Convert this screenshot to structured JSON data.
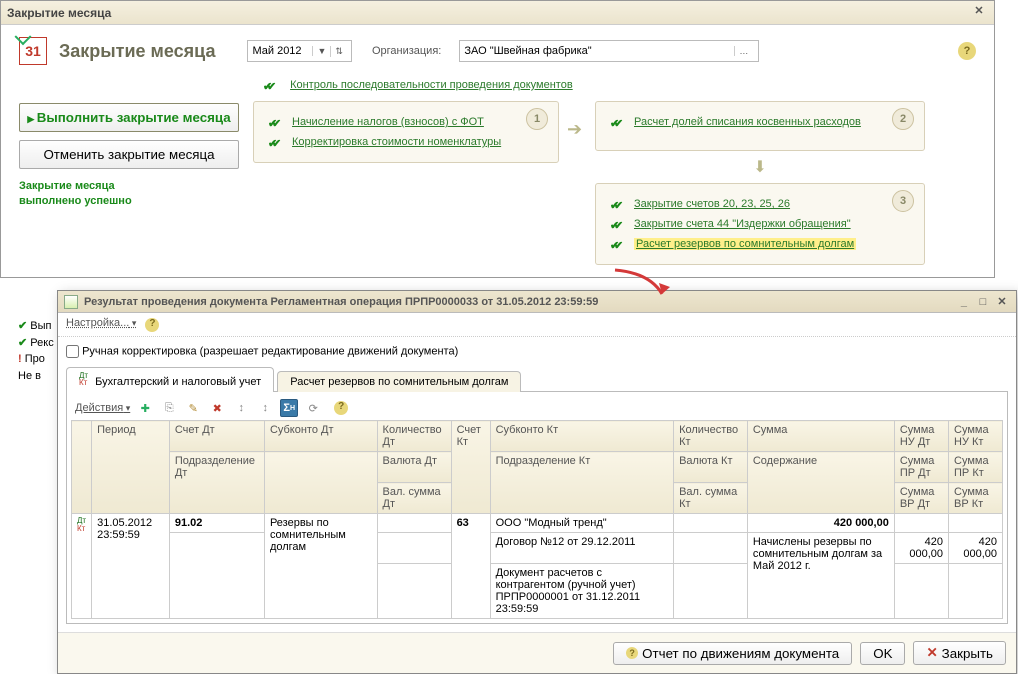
{
  "window": {
    "title": "Закрытие месяца"
  },
  "header": {
    "cal_day": "31",
    "title": "Закрытие месяца",
    "period": "Май 2012",
    "org_label": "Организация:",
    "org_value": "ЗАО \"Швейная фабрика\""
  },
  "left": {
    "execute": "Выполнить закрытие месяца",
    "cancel": "Отменить закрытие месяца",
    "success_l1": "Закрытие месяца",
    "success_l2": "выполнено успешно"
  },
  "ctrl_link": "Контроль последовательности проведения документов",
  "step1": {
    "num": "1",
    "link1": "Начисление налогов (взносов) с ФОТ",
    "link2": "Корректировка стоимости номенклатуры"
  },
  "step2": {
    "num": "2",
    "link1": "Расчет долей списания косвенных расходов"
  },
  "step3": {
    "num": "3",
    "link1": "Закрытие счетов 20, 23, 25, 26",
    "link2": "Закрытие счета 44 \"Издержки обращения\"",
    "link3": "Расчет резервов по сомнительным долгам"
  },
  "cut": {
    "l1": "Вып",
    "l2": "Рекс",
    "l3": "Про",
    "l4": "Не в"
  },
  "overlay": {
    "title": "Результат проведения документа Регламентная операция ПРПР0000033 от 31.05.2012 23:59:59",
    "menu_settings": "Настройка...",
    "checkbox_label": "Ручная корректировка (разрешает редактирование движений документа)",
    "tab1": "Бухгалтерский и налоговый учет",
    "tab2": "Расчет резервов по сомнительным долгам",
    "actions": "Действия",
    "footer_report": "Отчет по движениям документа",
    "footer_ok": "OK",
    "footer_close": "Закрыть"
  },
  "grid": {
    "headers": {
      "r1": {
        "period": "Период",
        "acc_dt": "Счет Дт",
        "sub_dt": "Субконто Дт",
        "qty_dt": "Количество Дт",
        "acc_kt": "Счет Кт",
        "sub_kt": "Субконто Кт",
        "qty_kt": "Количество Кт",
        "sum": "Сумма",
        "nu_dt": "Сумма НУ Дт",
        "nu_kt": "Сумма НУ Кт"
      },
      "r2": {
        "div_dt": "Подразделение Дт",
        "val_dt": "Валюта Дт",
        "div_kt": "Подразделение Кт",
        "val_kt": "Валюта Кт",
        "content": "Содержание",
        "pr_dt": "Сумма ПР Дт",
        "pr_kt": "Сумма ПР Кт"
      },
      "r3": {
        "vsum_dt": "Вал. сумма Дт",
        "vsum_kt": "Вал. сумма Кт",
        "vr_dt": "Сумма ВР Дт",
        "vr_kt": "Сумма ВР Кт"
      }
    },
    "rows": [
      {
        "period": "31.05.2012 23:59:59",
        "acc_dt": "91.02",
        "sub_dt": "Резервы по сомнительным долгам",
        "acc_kt": "63",
        "sub_kt_l1": "ООО \"Модный тренд\"",
        "sub_kt_l2": "Договор №12 от 29.12.2011",
        "sub_kt_l3": "Документ расчетов с контрагентом (ручной учет) ПРПР0000001 от 31.12.2011 23:59:59",
        "sum": "420 000,00",
        "content": "Начислены резервы по сомнительным долгам за Май 2012 г.",
        "nu_dt": "420 000,00",
        "nu_kt": "420 000,00"
      }
    ]
  }
}
